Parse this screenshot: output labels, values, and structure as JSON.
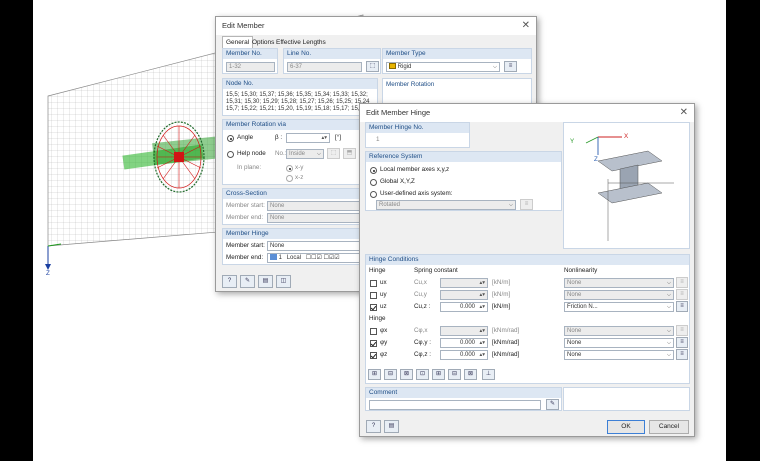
{
  "edit_member": {
    "title": "Edit Member",
    "tabs": [
      "General",
      "Options",
      "Effective Lengths"
    ],
    "member_no_header": "Member No.",
    "member_no": "1-32",
    "line_no_header": "Line No.",
    "line_no": "6-37",
    "member_type_header": "Member Type",
    "member_type": "Rigid",
    "member_type_color": "#e8b400",
    "node_no_header": "Node No.",
    "node_lines": [
      "15,5; 15,30; 15,37; 15,36; 15,35; 15,34; 15,33; 15,32;",
      "15,31; 15,30; 15,29; 15,28; 15,27; 15,26; 15,25; 15,24",
      "15,7; 15,22; 15,21; 15,20, 15,19; 15,18; 15,17; 15,16"
    ],
    "member_rotation_header": "Member Rotation",
    "member_rotation_via_header": "Member Rotation via",
    "angle_label": "Angle",
    "beta_label": "β :",
    "beta_unit": "[°]",
    "help_node_label": "Help node",
    "no_label": "No.:",
    "inside_value": "Inside",
    "in_plane_label": "In plane:",
    "plane_xy": "x-y",
    "plane_xz": "x-z",
    "cross_section_header": "Cross-Section",
    "member_start_label": "Member start:",
    "member_end_label": "Member end:",
    "cs_start": "None",
    "cs_end": "None",
    "member_hinge_header": "Member Hinge",
    "hinge_start": "None",
    "hinge_end_no": "1",
    "hinge_end_sys": "Local"
  },
  "hinge": {
    "title": "Edit Member Hinge",
    "hinge_no_header": "Member Hinge No.",
    "hinge_no": "1",
    "reference_header": "Reference System",
    "ref_local": "Local member axes x,y,z",
    "ref_global": "Global X,Y,Z",
    "ref_user": "User-defined axis system:",
    "ref_user_value": "Rotated",
    "conditions_header": "Hinge Conditions",
    "col_hinge": "Hinge",
    "col_spring": "Spring constant",
    "col_nonlin": "Nonlinearity",
    "col_hinge2": "Hinge",
    "trans_rows": [
      {
        "label": "ux",
        "checked": false,
        "const": "Cu,x",
        "value": "",
        "unit": "[kN/m]",
        "nonlin": "None",
        "active": false
      },
      {
        "label": "uy",
        "checked": false,
        "const": "Cu,y",
        "value": "",
        "unit": "[kN/m]",
        "nonlin": "None",
        "active": false
      },
      {
        "label": "uz",
        "checked": true,
        "const": "Cu,z :",
        "value": "0.000",
        "unit": "[kN/m]",
        "nonlin": "Friction N...",
        "active": true
      }
    ],
    "rot_rows": [
      {
        "label": "φx",
        "checked": false,
        "const": "Cφ,x",
        "value": "",
        "unit": "[kNm/rad]",
        "nonlin": "None",
        "active": false
      },
      {
        "label": "φy",
        "checked": true,
        "const": "Cφ,y :",
        "value": "0.000",
        "unit": "[kNm/rad]",
        "nonlin": "None",
        "active": true
      },
      {
        "label": "φz",
        "checked": true,
        "const": "Cφ,z :",
        "value": "0.000",
        "unit": "[kNm/rad]",
        "nonlin": "None",
        "active": true
      }
    ],
    "comment_header": "Comment",
    "comment_value": "",
    "ok_label": "OK",
    "cancel_label": "Cancel"
  },
  "view": {
    "axis_label": "Z",
    "graphic_axes": {
      "y": "Y",
      "x": "X",
      "z": "Z"
    }
  }
}
